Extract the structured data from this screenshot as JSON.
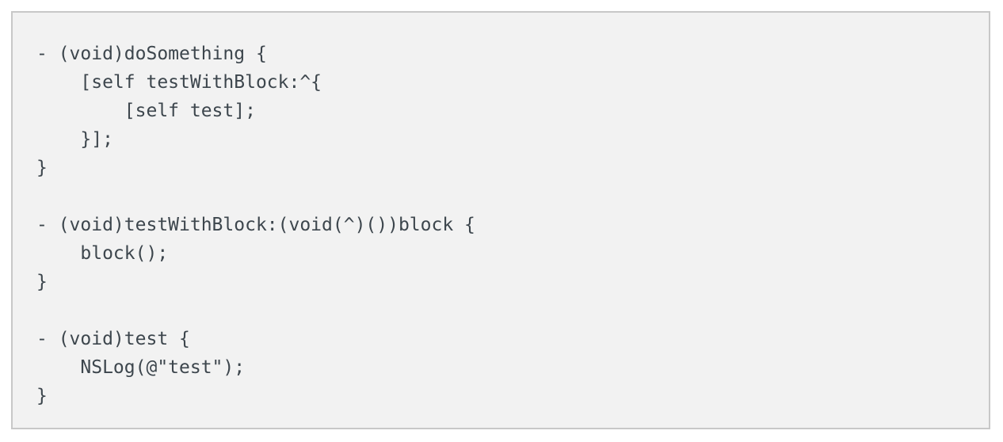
{
  "code": {
    "lines": [
      "- (void)doSomething {",
      "    [self testWithBlock:^{",
      "        [self test];",
      "    }];",
      "}",
      "",
      "- (void)testWithBlock:(void(^)())block {",
      "    block();",
      "}",
      "",
      "- (void)test {",
      "    NSLog(@\"test\");",
      "}"
    ]
  }
}
